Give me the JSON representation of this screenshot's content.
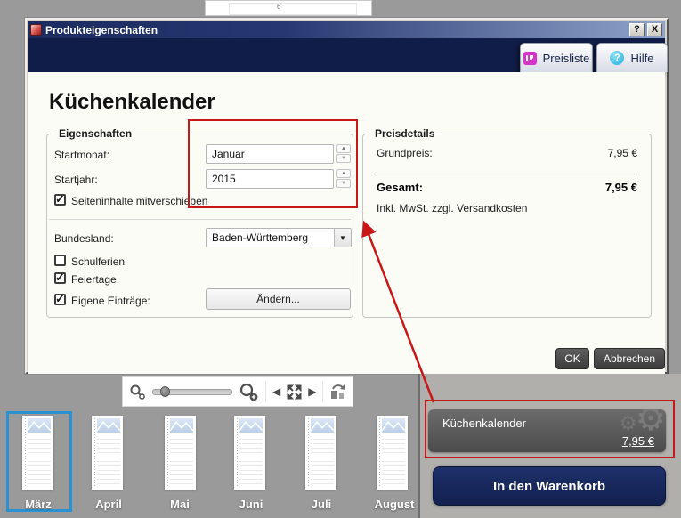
{
  "window": {
    "title": "Produkteigenschaften",
    "help_glyph": "?",
    "close_glyph": "X"
  },
  "header": {
    "preisliste_label": "Preisliste",
    "hilfe_label": "Hilfe",
    "hilfe_glyph": "?"
  },
  "product": {
    "title": "Küchenkalender"
  },
  "eigenschaften": {
    "legend": "Eigenschaften",
    "startmonat_label": "Startmonat:",
    "startmonat_value": "Januar",
    "startjahr_label": "Startjahr:",
    "startjahr_value": "2015",
    "checkbox_mitverschieben": {
      "label": "Seiteninhalte mitverschieben",
      "checked": true
    },
    "bundesland_label": "Bundesland:",
    "bundesland_value": "Baden-Württemberg",
    "checkbox_schulferien": {
      "label": "Schulferien",
      "checked": false
    },
    "checkbox_feiertage": {
      "label": "Feiertage",
      "checked": true
    },
    "checkbox_eigene": {
      "label": "Eigene Einträge:",
      "checked": true
    },
    "aendern_button": "Ändern..."
  },
  "preisdetails": {
    "legend": "Preisdetails",
    "grundpreis_label": "Grundpreis:",
    "grundpreis_value": "7,95 €",
    "gesamt_label": "Gesamt:",
    "gesamt_value": "7,95 €",
    "note": "Inkl. MwSt. zzgl. Versandkosten"
  },
  "dialog_buttons": {
    "ok": "OK",
    "cancel": "Abbrechen"
  },
  "toolbar": {
    "icons": [
      "zoom-out-icon",
      "zoom-slider",
      "zoom-in-icon",
      "prev-arrow-icon",
      "fit-view-icon",
      "next-arrow-icon",
      "rotate-page-icon"
    ],
    "prev_glyph": "◀",
    "next_glyph": "▶"
  },
  "thumbnails": {
    "months": [
      "März",
      "April",
      "Mai",
      "Juni",
      "Juli",
      "August"
    ],
    "selected_month": "März"
  },
  "cart": {
    "product_name": "Küchenkalender",
    "price": "7,95 €",
    "add_to_cart_label": "In den Warenkorb",
    "gear_glyph": "⚙"
  },
  "background": {
    "page_number": "6"
  },
  "colors": {
    "accent_navy": "#13214f",
    "annotation_red": "#c81717",
    "selection_blue": "#2a92d2",
    "preisliste_pink": "#d633c9",
    "hilfe_cyan": "#1fb0dd"
  }
}
